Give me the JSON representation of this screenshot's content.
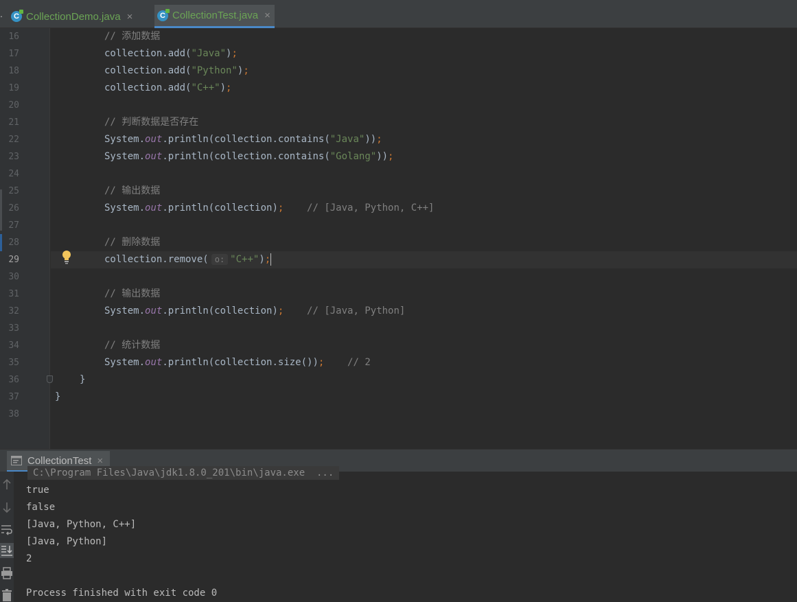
{
  "tabs": {
    "overflow": ".",
    "items": [
      {
        "label": "CollectionDemo.java",
        "close": "×",
        "icon": "java-class-icon"
      },
      {
        "label": "CollectionTest.java",
        "close": "×",
        "icon": "java-class-icon"
      }
    ]
  },
  "editor": {
    "line_numbers": [
      "16",
      "17",
      "18",
      "19",
      "20",
      "21",
      "22",
      "23",
      "24",
      "25",
      "26",
      "27",
      "28",
      "29",
      "30",
      "31",
      "32",
      "33",
      "34",
      "35",
      "36",
      "37",
      "38"
    ],
    "current_line": "29",
    "l16": {
      "comment": "// 添加数据"
    },
    "l17": {
      "a": "collection.add(",
      "s": "\"Java\"",
      "b": ")",
      "semi": ";"
    },
    "l18": {
      "a": "collection.add(",
      "s": "\"Python\"",
      "b": ")",
      "semi": ";"
    },
    "l19": {
      "a": "collection.add(",
      "s": "\"C++\"",
      "b": ")",
      "semi": ";"
    },
    "l21": {
      "comment": "// 判断数据是否存在"
    },
    "l22": {
      "sys": "System.",
      "out": "out",
      "a": ".println(collection.contains(",
      "s": "\"Java\"",
      "b": "))",
      "semi": ";"
    },
    "l23": {
      "sys": "System.",
      "out": "out",
      "a": ".println(collection.contains(",
      "s": "\"Golang\"",
      "b": "))",
      "semi": ";"
    },
    "l25": {
      "comment": "// 输出数据"
    },
    "l26": {
      "sys": "System.",
      "out": "out",
      "a": ".println(collection)",
      "semi": ";",
      "trail": "    // [Java, Python, C++]"
    },
    "l28": {
      "comment": "// 删除数据"
    },
    "l29": {
      "a": "collection.remove(",
      "hint": "o:",
      "s": "\"C++\"",
      "b": ")",
      "semi": ";"
    },
    "l31": {
      "comment": "// 输出数据"
    },
    "l32": {
      "sys": "System.",
      "out": "out",
      "a": ".println(collection)",
      "semi": ";",
      "trail": "    // [Java, Python]"
    },
    "l34": {
      "comment": "// 统计数据"
    },
    "l35": {
      "sys": "System.",
      "out": "out",
      "a": ".println(collection.size())",
      "semi": ";",
      "trail": "    // 2"
    },
    "l36": {
      "text": "}"
    },
    "l37": {
      "text": "}"
    }
  },
  "run": {
    "tab_label": "CollectionTest",
    "tab_close": "×",
    "command": "C:\\Program Files\\Java\\jdk1.8.0_201\\bin\\java.exe  ...",
    "output": [
      "true",
      "false",
      "[Java, Python, C++]",
      "[Java, Python]",
      "2",
      "",
      "Process finished with exit code 0"
    ]
  },
  "colors": {
    "background": "#2b2b2b",
    "string": "#6a8759",
    "static_field": "#9876aa",
    "comment": "#808080",
    "semicolon": "#cc7832",
    "accent": "#4a88c7"
  }
}
